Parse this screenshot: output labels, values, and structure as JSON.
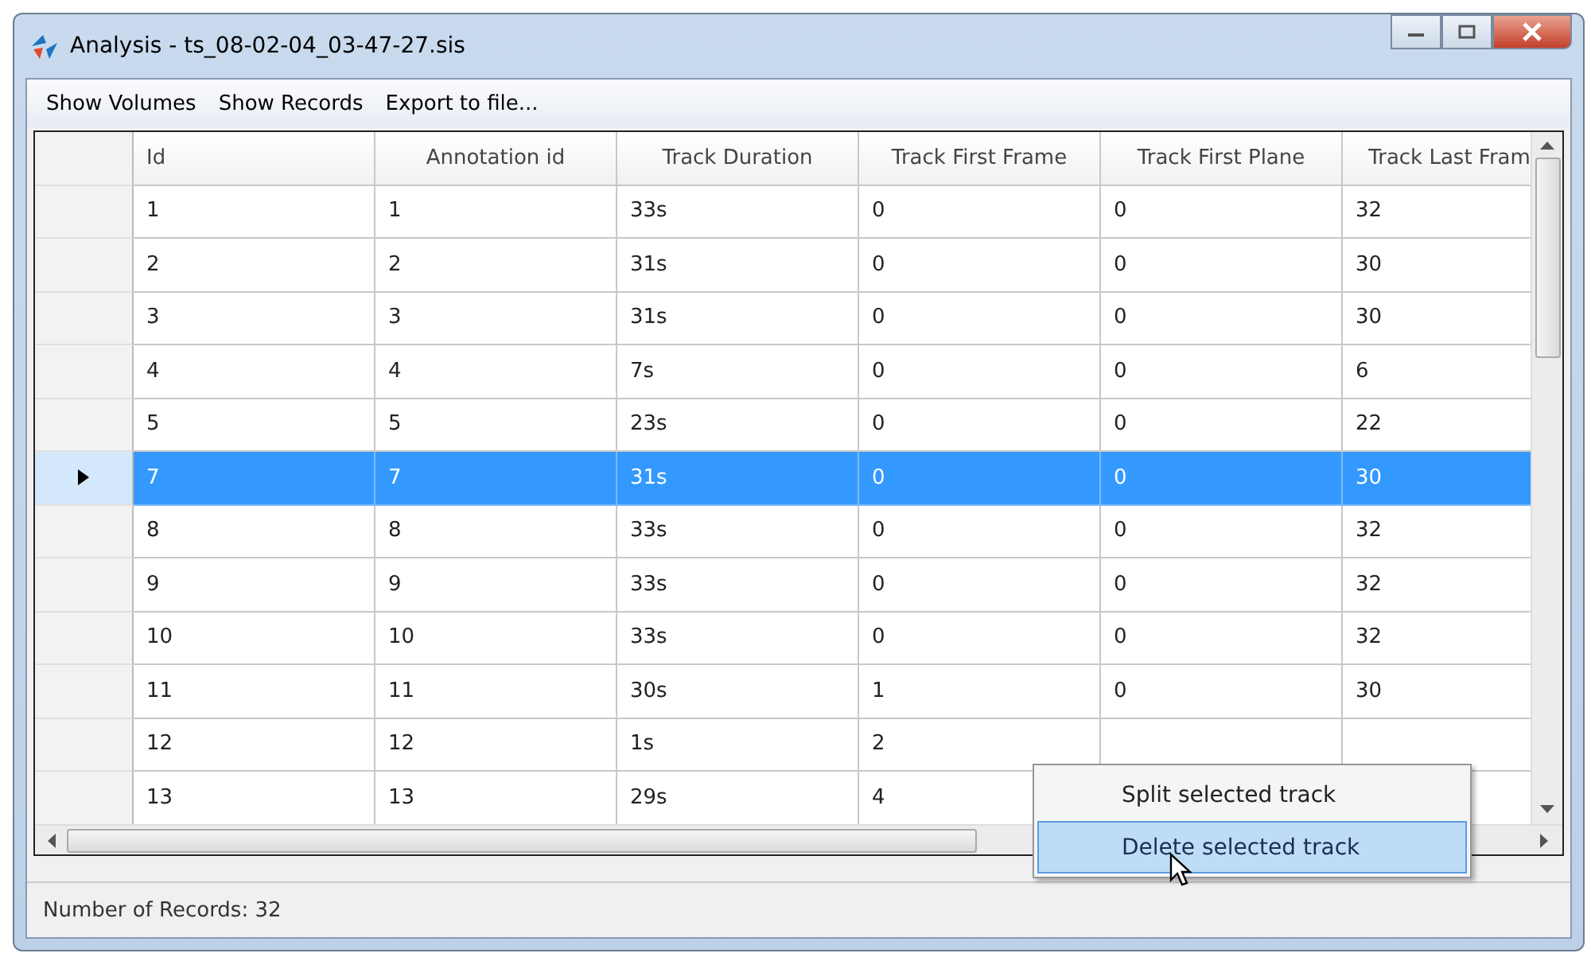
{
  "window": {
    "title": "Analysis - ts_08-02-04_03-47-27.sis"
  },
  "menu_bar": [
    "Show Volumes",
    "Show Records",
    "Export to file..."
  ],
  "table": {
    "columns": [
      "Id",
      "Annotation id",
      "Track Duration",
      "Track First Frame",
      "Track First Plane",
      "Track Last Fram"
    ],
    "rows": [
      {
        "selected": false,
        "cells": [
          "1",
          "1",
          "33s",
          "0",
          "0",
          "32"
        ]
      },
      {
        "selected": false,
        "cells": [
          "2",
          "2",
          "31s",
          "0",
          "0",
          "30"
        ]
      },
      {
        "selected": false,
        "cells": [
          "3",
          "3",
          "31s",
          "0",
          "0",
          "30"
        ]
      },
      {
        "selected": false,
        "cells": [
          "4",
          "4",
          "7s",
          "0",
          "0",
          "6"
        ]
      },
      {
        "selected": false,
        "cells": [
          "5",
          "5",
          "23s",
          "0",
          "0",
          "22"
        ]
      },
      {
        "selected": true,
        "cells": [
          "7",
          "7",
          "31s",
          "0",
          "0",
          "30"
        ]
      },
      {
        "selected": false,
        "cells": [
          "8",
          "8",
          "33s",
          "0",
          "0",
          "32"
        ]
      },
      {
        "selected": false,
        "cells": [
          "9",
          "9",
          "33s",
          "0",
          "0",
          "32"
        ]
      },
      {
        "selected": false,
        "cells": [
          "10",
          "10",
          "33s",
          "0",
          "0",
          "32"
        ]
      },
      {
        "selected": false,
        "cells": [
          "11",
          "11",
          "30s",
          "1",
          "0",
          "30"
        ]
      },
      {
        "selected": false,
        "cells": [
          "12",
          "12",
          "1s",
          "2"
        ]
      },
      {
        "selected": false,
        "cells": [
          "13",
          "13",
          "29s",
          "4"
        ]
      }
    ]
  },
  "context_menu": [
    {
      "label": "Split selected track",
      "selected": false
    },
    {
      "label": "Delete selected track",
      "selected": true
    }
  ],
  "status_bar": "Number of Records: 32"
}
